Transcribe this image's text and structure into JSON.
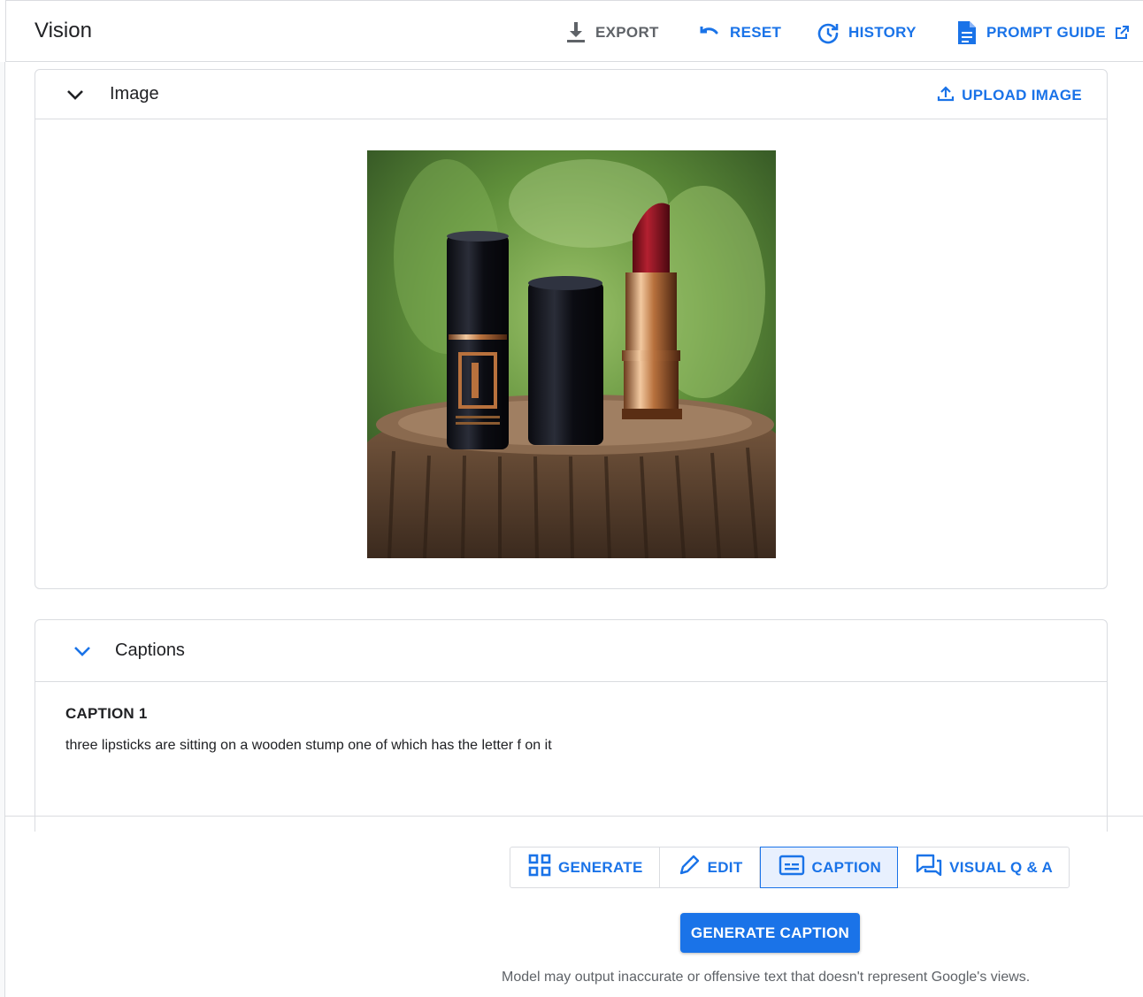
{
  "header": {
    "title": "Vision",
    "export_label": "EXPORT",
    "reset_label": "RESET",
    "history_label": "HISTORY",
    "prompt_guide_label": "PROMPT GUIDE"
  },
  "image_panel": {
    "title": "Image",
    "upload_label": "UPLOAD IMAGE"
  },
  "captions_panel": {
    "title": "Captions",
    "caption_heading": "CAPTION 1",
    "caption_text": "three lipsticks are sitting on a wooden stump one of which has the letter f on it"
  },
  "mode_tabs": [
    {
      "label": "GENERATE",
      "icon": "grid-icon",
      "active": false
    },
    {
      "label": "EDIT",
      "icon": "pencil-icon",
      "active": false
    },
    {
      "label": "CAPTION",
      "icon": "caption-icon",
      "active": true
    },
    {
      "label": "VISUAL Q & A",
      "icon": "chat-icon",
      "active": false
    }
  ],
  "generate_button_label": "GENERATE CAPTION",
  "disclaimer": "Model may output inaccurate or offensive text that doesn't represent Google's views.",
  "colors": {
    "accent": "#1a73e8",
    "disabled": "#5f6368",
    "border": "#dadce0",
    "active_tab_bg": "#e8f0fe"
  }
}
